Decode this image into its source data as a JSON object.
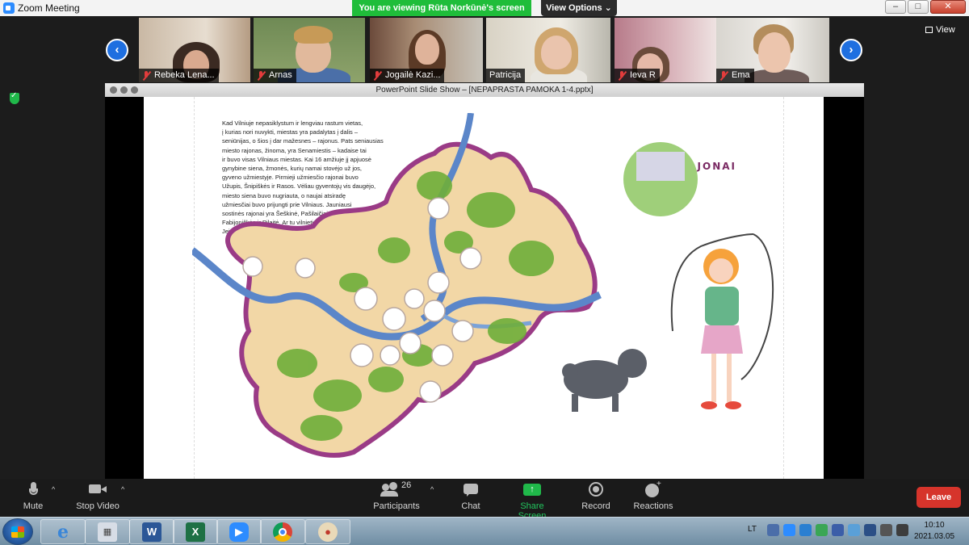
{
  "window": {
    "title": "Zoom Meeting"
  },
  "banner": {
    "viewing": "You are viewing Rūta Norkūnė's screen",
    "view_options": "View Options"
  },
  "view_button": {
    "label": "View"
  },
  "participants_strip": [
    {
      "name": "Rebeka Lena...",
      "muted": true
    },
    {
      "name": "Arnas",
      "muted": true
    },
    {
      "name": "Jogailė Kazi...",
      "muted": true
    },
    {
      "name": "Patricija",
      "muted": false
    },
    {
      "name": "Ieva R",
      "muted": true
    },
    {
      "name": "Ema",
      "muted": true
    }
  ],
  "shared_window": {
    "title": "PowerPoint Slide Show – [NEPAPRASTA PAMOKA 1-4.pptx]",
    "slide": {
      "text": "Kad Vilniuje nepasiklystum ir lengviau rastum vietas,\nį kurias nori nuvykti, miestas yra padalytas į dalis –\nseniūnijas, o šios į dar mažesnes – rajonus. Pats seniausias\nmiesto rajonas, žinoma, yra Senamiestis – kadaise tai\nir buvo visas Vilniaus miestas. Kai 16 amžiuje jį apjuosė\ngynybine siena, žmonės, kurių namai stovėjo už jos,\ngyveno užmiestyje. Pirmieji užmiesčio rajonai buvo\nUžupis, Šnipiškės ir Rasos. Vėliau gyventojų vis daugėjo,\nmiesto siena buvo nugriauta, o naujai atsiradę\nužmiesčiai buvo prijungti prie Vilniaus. Jauniausi\nsostinės rajonai yra Šeškinė, Pašilaičiai,\nFabijoniškės ir Pilaitė. Ar tu vilnietis?\nJei taip, kuriame rajone gyveni?",
      "heading": "RAJONAI"
    }
  },
  "toolbar": {
    "mute": "Mute",
    "stop_video": "Stop Video",
    "participants": "Participants",
    "participants_count": "26",
    "chat": "Chat",
    "share_screen": "Share Screen",
    "record": "Record",
    "reactions": "Reactions",
    "leave": "Leave"
  },
  "taskbar": {
    "apps": [
      "internet-explorer",
      "calculator",
      "word",
      "excel",
      "zoom",
      "chrome",
      "paint"
    ],
    "language": "LT",
    "time": "10:10",
    "date": "2021.03.05"
  },
  "colors": {
    "share_green": "#1fbd3a",
    "leave_red": "#d6342b",
    "nav_blue": "#1e6fe0",
    "river": "#5b86c9",
    "city_border": "#9a3b86"
  }
}
